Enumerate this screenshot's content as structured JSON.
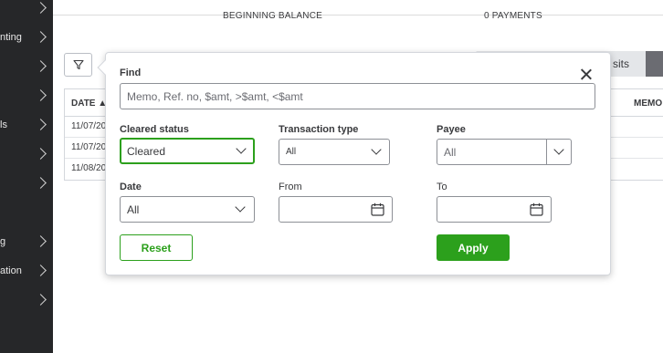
{
  "sidebar": {
    "items": [
      {
        "label": "",
        "icon": "chevron-right-icon"
      },
      {
        "label": "nting",
        "icon": "chevron-right-icon"
      },
      {
        "label": "",
        "icon": "chevron-right-icon"
      },
      {
        "label": "",
        "icon": "chevron-right-icon"
      },
      {
        "label": "ls",
        "icon": "chevron-right-icon"
      },
      {
        "label": "",
        "icon": "chevron-right-icon"
      },
      {
        "label": "",
        "icon": "chevron-right-icon"
      },
      {
        "label": "g",
        "icon": "chevron-right-icon"
      },
      {
        "label": "ation",
        "icon": "chevron-right-icon"
      },
      {
        "label": "",
        "icon": "chevron-right-icon"
      }
    ]
  },
  "summary": {
    "beginning_balance_label": "BEGINNING BALANCE",
    "payments_label": "0 PAYMENTS"
  },
  "tabs": {
    "deposits_label": "sits"
  },
  "table": {
    "headers": {
      "date": "DATE ▲",
      "memo": "MEMO"
    },
    "rows": [
      {
        "date": "11/07/20"
      },
      {
        "date": "11/07/20"
      },
      {
        "date": "11/08/20"
      }
    ]
  },
  "filter": {
    "find_label": "Find",
    "find_placeholder": "Memo, Ref. no, $amt, >$amt, <$amt",
    "cleared_status_label": "Cleared status",
    "cleared_status_value": "Cleared",
    "transaction_type_label": "Transaction type",
    "transaction_type_value": "All",
    "payee_label": "Payee",
    "payee_value": "All",
    "date_label": "Date",
    "date_value": "All",
    "from_label": "From",
    "from_value": "",
    "to_label": "To",
    "to_value": "",
    "reset_label": "Reset",
    "apply_label": "Apply"
  },
  "colors": {
    "accent_green": "#2ca01c",
    "sidebar_bg": "#262729"
  }
}
